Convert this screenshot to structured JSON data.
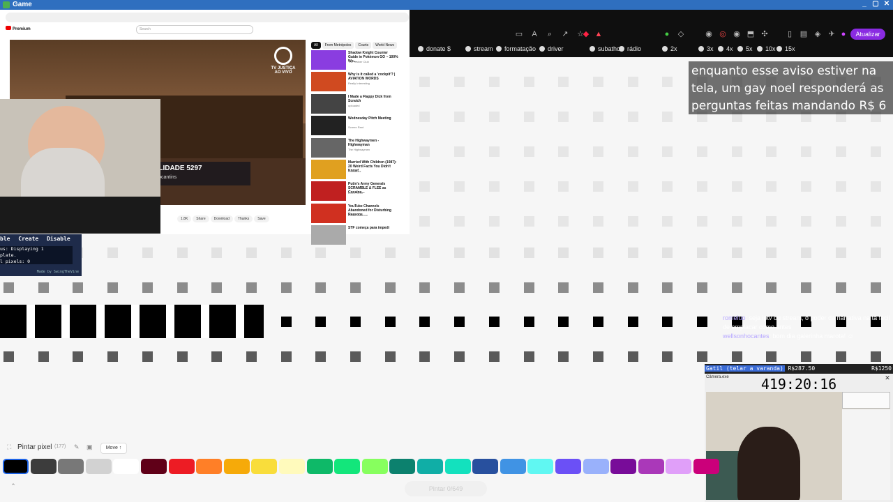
{
  "window": {
    "title": "Game"
  },
  "browser": {
    "update_label": "Atualizar",
    "bookmarks": [
      "donate $",
      "stream",
      "formatação",
      "driver",
      "subathon",
      "rádio",
      "2x",
      "3x",
      "4x",
      "5x",
      "10x",
      "15x"
    ]
  },
  "youtube": {
    "lower_third_title": "INCONSTITUCIONALIDADE 5297",
    "lower_third_sub": "de delegados do Tocantins",
    "channel_badge": "TV JUSTIÇA AO VIVO",
    "search_placeholder": "Search",
    "logo": "Premium",
    "chips": [
      "All",
      "From Metrópoles",
      "Courts",
      "World News"
    ],
    "recommendations": [
      {
        "title": "Shadow Knight Counter Guide in Pokémon GO ~ 100% Wo...",
        "meta": "The Trainer Club"
      },
      {
        "title": "Why is it called a 'cockpit'? | AVIATION WORDS",
        "meta": "Really Interesting"
      },
      {
        "title": "I Made a Flappy Dick from Scratch",
        "meta": "uploaded"
      },
      {
        "title": "Wednesday Pitch Meeting",
        "meta": "Screen Rant"
      },
      {
        "title": "The Highwaymen - Highwayman",
        "meta": "The Highwaymen"
      },
      {
        "title": "Married With Children (1987): 20 Weird Facts You Didn't Know!",
        "meta": "Showbuzz"
      },
      {
        "title": "Putin's Army Generals SCRAMBLE & FLEE as Cocaine...",
        "meta": "Lost in Web"
      },
      {
        "title": "YouTube Channels Abandoned for Disturbing Reasons",
        "meta": "Chisel Cadence"
      },
      {
        "title": "STF começa para impedi",
        "meta": ""
      }
    ],
    "actions": [
      "1.8K",
      "Share",
      "Download",
      "Thanks",
      "Save"
    ]
  },
  "script_panel": {
    "buttons": [
      "ble",
      "Create",
      "Disable"
    ],
    "log": "us: Displaying 1\nplate.\nl pixels: 0",
    "credit": "Made by SwingTheVine"
  },
  "overlay": {
    "notice": "enquanto esse aviso estiver na tela, um gay noel responderá as perguntas feitas mandando R$ 6",
    "chat": [
      {
        "name": "romeluo",
        "text": ": seja iptv ou stream, o poder da narrativa na tá fácil de emplacar como antes"
      },
      {
        "name": "wellsonhocantes",
        "text": ": bom dia galerinha marota! ☺"
      }
    ]
  },
  "stream_cam": {
    "goal_label": "Gatil (telar a varanda)",
    "goal_amount": "R$287.50",
    "goal_target": "R$1250",
    "window_title": "Câmera.exe",
    "timer": "419:20:16"
  },
  "toolbar": {
    "tool_label": "Pintar pixel",
    "pixel_count": "(177)",
    "move_label": "Move ↑",
    "paint_button": "Pintar 0/649"
  },
  "palette": [
    "#000000",
    "#3c3c3c",
    "#787878",
    "#d2d2d2",
    "#ffffff",
    "#600018",
    "#ed1c24",
    "#ff7f27",
    "#f6aa09",
    "#f9dd3b",
    "#fffabc",
    "#0eb968",
    "#13e67b",
    "#87ff5e",
    "#0c816e",
    "#10aea6",
    "#13e1be",
    "#28509e",
    "#4093e4",
    "#60f7f2",
    "#6b50f6",
    "#99b1fb",
    "#780c99",
    "#aa38b9",
    "#e09ff9",
    "#cb007a"
  ],
  "colors": {
    "accent": "#1d63e6",
    "window_bar": "#2f6fbf",
    "pixel_black": "#000000",
    "pixel_gray": "#a9a9a9"
  }
}
